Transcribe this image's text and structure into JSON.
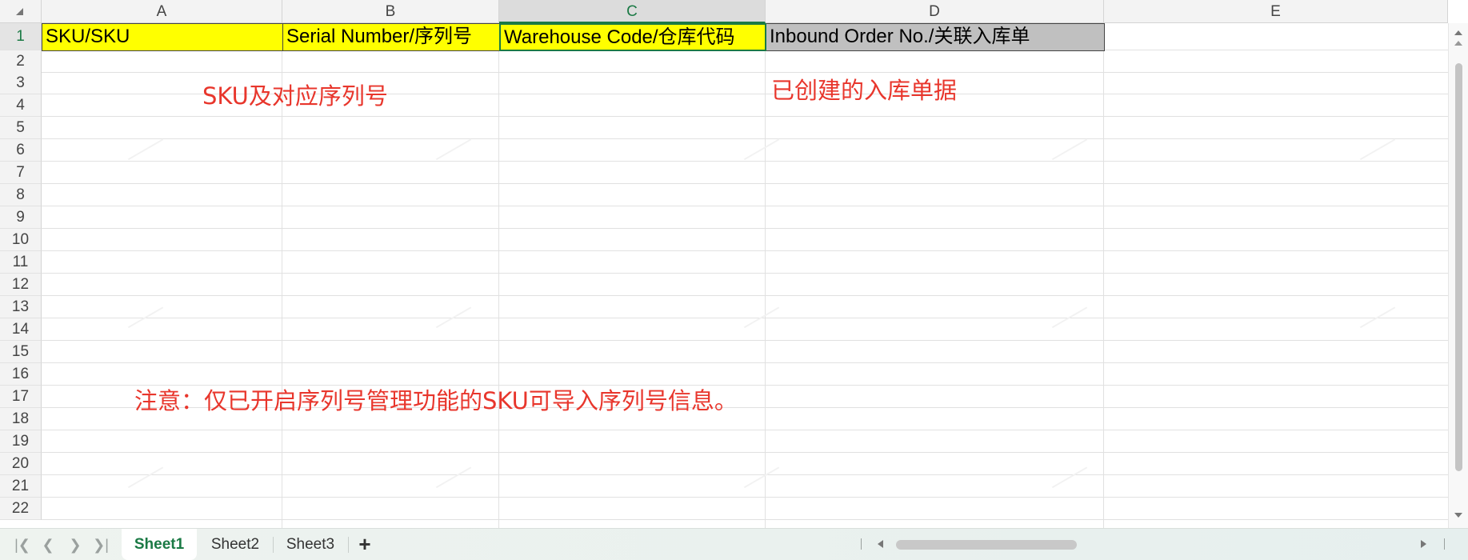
{
  "columns": [
    "A",
    "B",
    "C",
    "D",
    "E"
  ],
  "rows": [
    "1",
    "2",
    "3",
    "4",
    "5",
    "6",
    "7",
    "8",
    "9",
    "10",
    "11",
    "12",
    "13",
    "14",
    "15",
    "16",
    "17",
    "18",
    "19",
    "20",
    "21",
    "22"
  ],
  "selected_column": "C",
  "selected_row": "1",
  "headers": {
    "a1": "SKU/SKU",
    "b1": "Serial Number/序列号",
    "c1": "Warehouse Code/仓库代码",
    "d1": "Inbound Order No./关联入库单"
  },
  "cell_colors": {
    "yellow_fill": "#ffff00",
    "gray_fill": "#c0c0c0",
    "selection_green": "#1b7a45",
    "annotation_red": "#e8362c"
  },
  "annotations": {
    "sku_note": "SKU及对应序列号",
    "inbound_note": "已创建的入库单据",
    "warning_note": "注意：仅已开启序列号管理功能的SKU可导入序列号信息。"
  },
  "sheet_tabs": [
    {
      "label": "Sheet1",
      "active": true
    },
    {
      "label": "Sheet2",
      "active": false
    },
    {
      "label": "Sheet3",
      "active": false
    }
  ],
  "icons": {
    "first_sheet": "first-sheet-icon",
    "prev_sheet": "prev-sheet-icon",
    "next_sheet": "next-sheet-icon",
    "last_sheet": "last-sheet-icon",
    "add_sheet": "plus-icon"
  }
}
